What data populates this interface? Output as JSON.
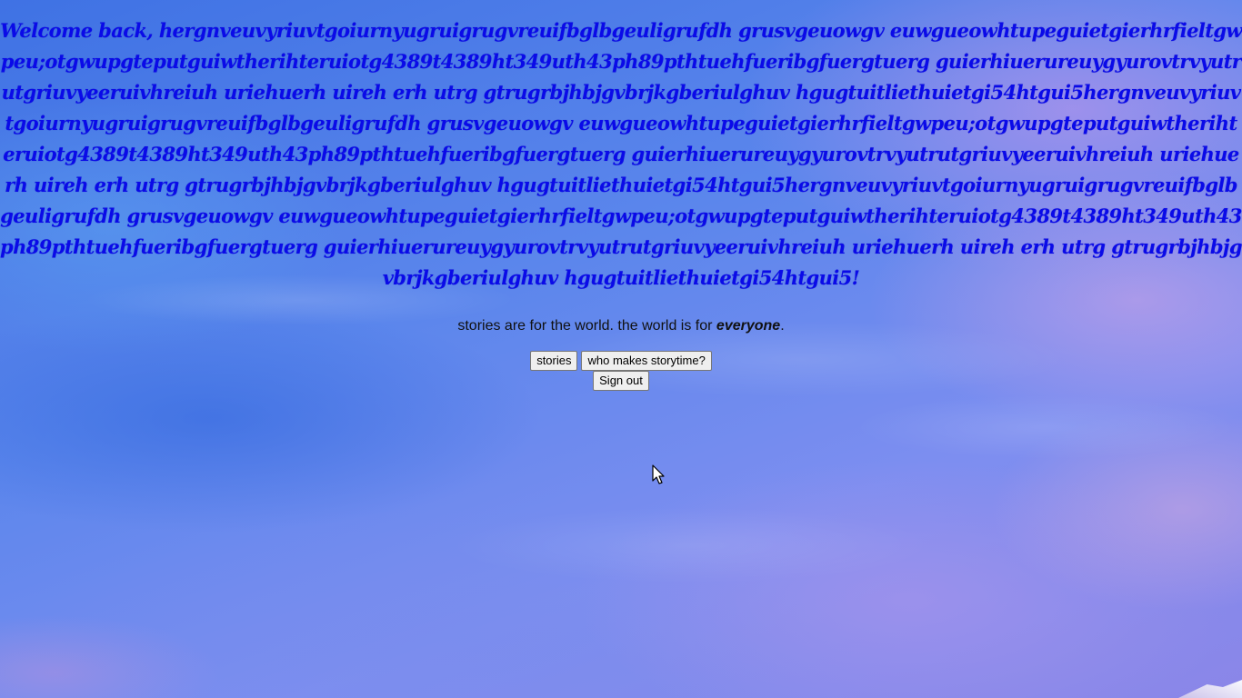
{
  "welcome": {
    "prefix": "Welcome back, ",
    "username": "hergnveuvyriuvtgoiurnyugruigrugvreuifbglbgeuligrufdh grusvgeuowgv euwgueowhtupeguietgierhrfieltgwpeu;otgwupgteputguiwtherihteruiotg4389t4389ht349uth43ph89pthtuehfueribgfuergtuerg guierhiuerureuygyurovtrvyutrutgriuvyeeruivhreiuh uriehuerh uireh erh utrg gtrugrbjhbjgvbrjkgberiulghuv hgugtuitliethuietgi54htgui5hergnveuvyriuvtgoiurnyugruigrugvreuifbglbgeuligrufdh grusvgeuowgv euwgueowhtupeguietgierhrfieltgwpeu;otgwupgteputguiwtherihteruiotg4389t4389ht349uth43ph89pthtuehfueribgfuergtuerg guierhiuerureuygyurovtrvyutrutgriuvyeeruivhreiuh uriehuerh uireh erh utrg gtrugrbjhbjgvbrjkgberiulghuv hgugtuitliethuietgi54htgui5hergnveuvyriuvtgoiurnyugruigrugvreuifbglbgeuligrufdh grusvgeuowgv euwgueowhtupeguietgierhrfieltgwpeu;otgwupgteputguiwtherihteruiotg4389t4389ht349uth43ph89pthtuehfueribgfuergtuerg guierhiuerureuygyurovtrvyutrutgriuvyeeruivhreiuh uriehuerh uireh erh utrg gtrugrbjhbjgvbrjkgberiulghuv hgugtuitliethuietgi54htgui5",
    "suffix": "!"
  },
  "tagline": {
    "text": "stories are for the world. the world is for ",
    "emphasis": "everyone",
    "end": "."
  },
  "nav": {
    "stories_label": "stories",
    "about_label": "who makes storytime?",
    "signout_label": "Sign out"
  },
  "colors": {
    "heading": "#0a0ae8",
    "sky": "#5d86ea"
  },
  "icons": {
    "cursor": "mouse-pointer-icon"
  }
}
